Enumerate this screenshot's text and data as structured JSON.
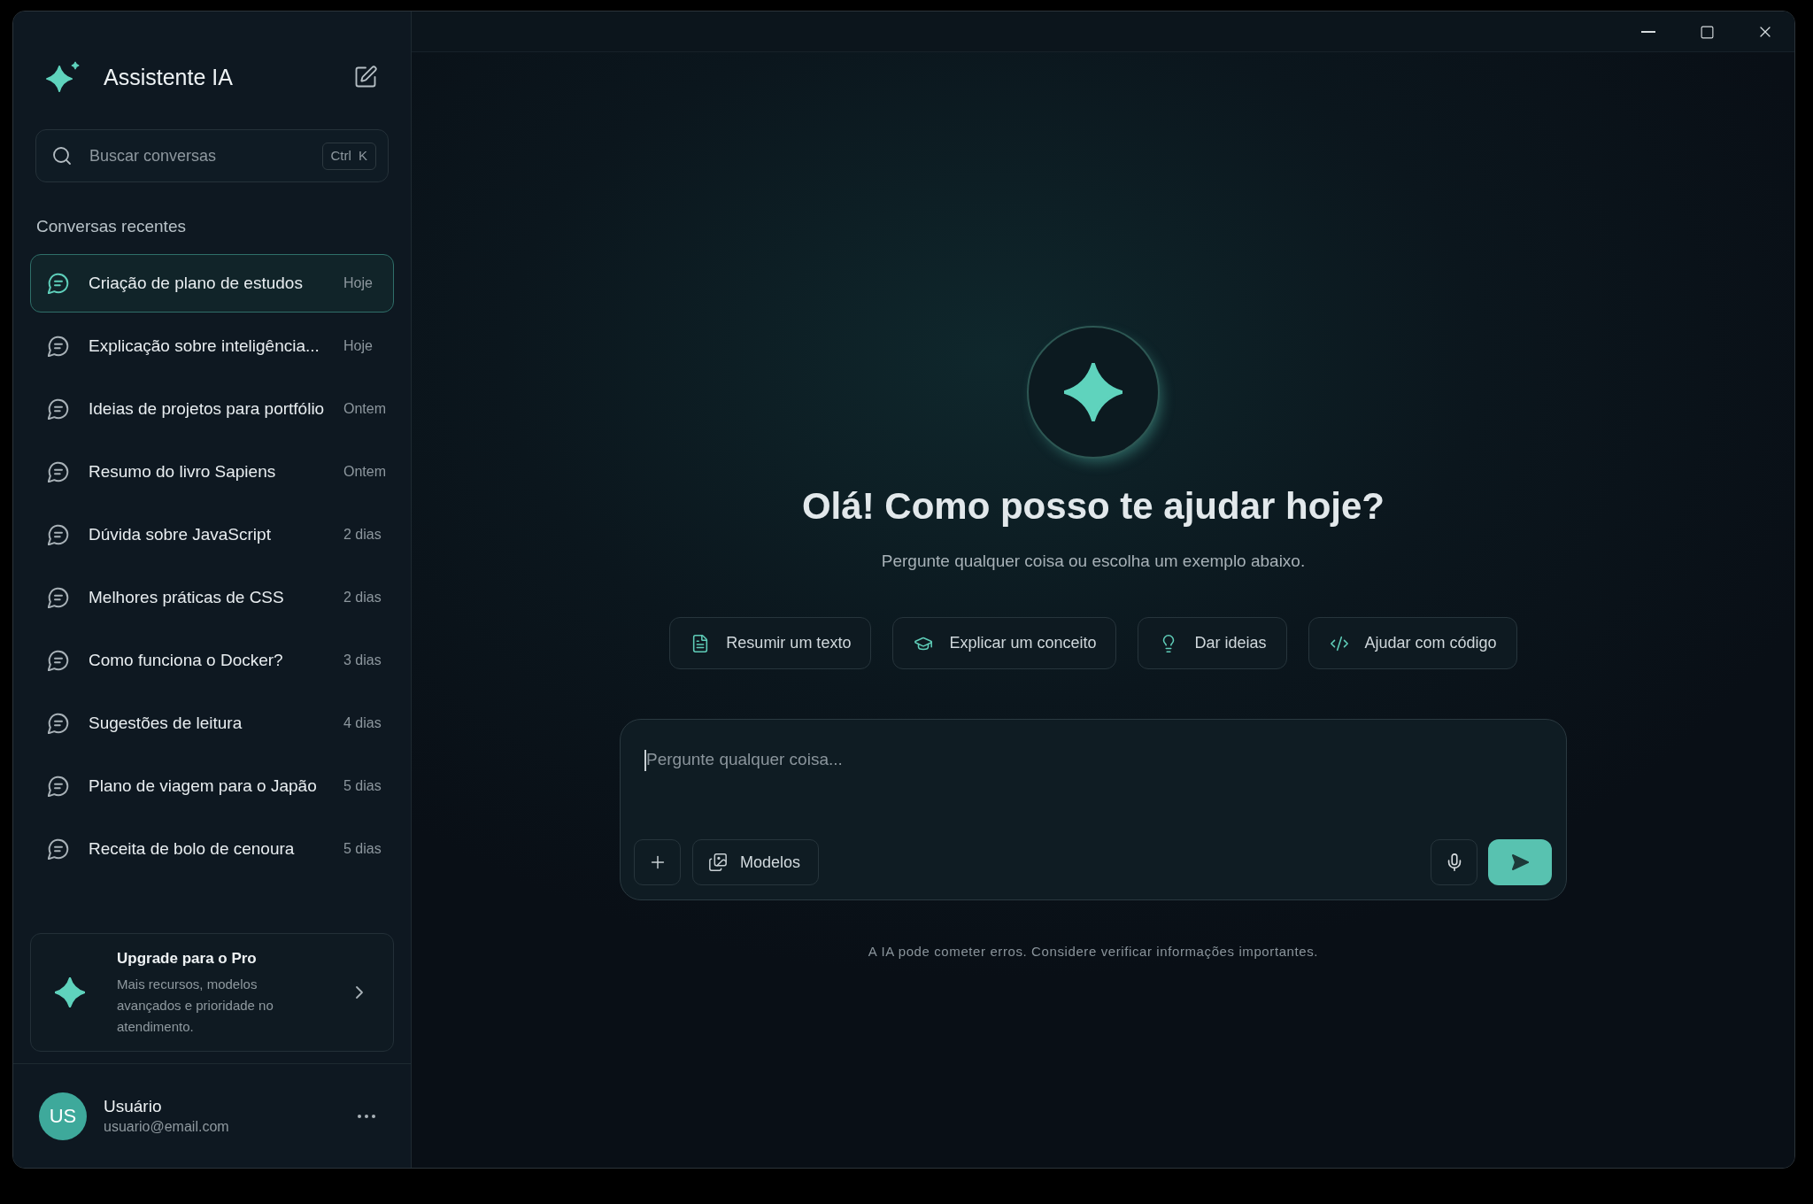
{
  "sidebar": {
    "app_title": "Assistente IA",
    "search": {
      "placeholder": "Buscar conversas",
      "shortcut": "Ctrl K"
    },
    "section_title": "Conversas recentes",
    "conversations": [
      {
        "title": "Criação de plano de estudos",
        "date": "Hoje",
        "selected": true
      },
      {
        "title": "Explicação sobre inteligência...",
        "date": "Hoje",
        "selected": false
      },
      {
        "title": "Ideias de projetos para portfólio",
        "date": "Ontem",
        "selected": false
      },
      {
        "title": "Resumo do livro Sapiens",
        "date": "Ontem",
        "selected": false
      },
      {
        "title": "Dúvida sobre JavaScript",
        "date": "2 dias",
        "selected": false
      },
      {
        "title": "Melhores práticas de CSS",
        "date": "2 dias",
        "selected": false
      },
      {
        "title": "Como funciona o Docker?",
        "date": "3 dias",
        "selected": false
      },
      {
        "title": "Sugestões de leitura",
        "date": "4 dias",
        "selected": false
      },
      {
        "title": "Plano de viagem para o Japão",
        "date": "5 dias",
        "selected": false
      },
      {
        "title": "Receita de bolo de cenoura",
        "date": "5 dias",
        "selected": false
      }
    ],
    "upgrade": {
      "title": "Upgrade para o Pro",
      "description": "Mais recursos, modelos avançados e prioridade no atendimento."
    },
    "user": {
      "initials": "US",
      "name": "Usuário",
      "email": "usuario@email.com"
    }
  },
  "main": {
    "heading": "Olá! Como posso te ajudar hoje?",
    "subheading": "Pergunte qualquer coisa ou escolha um exemplo abaixo.",
    "suggestions": [
      {
        "kind": "document",
        "label": "Resumir um texto"
      },
      {
        "kind": "learn",
        "label": "Explicar um conceito"
      },
      {
        "kind": "idea",
        "label": "Dar ideias"
      },
      {
        "kind": "code",
        "label": "Ajudar com código"
      }
    ],
    "composer": {
      "placeholder": "Pergunte qualquer coisa...",
      "models_button": "Modelos"
    },
    "disclaimer": "A IA pode cometer erros. Considere verificar informações importantes."
  }
}
